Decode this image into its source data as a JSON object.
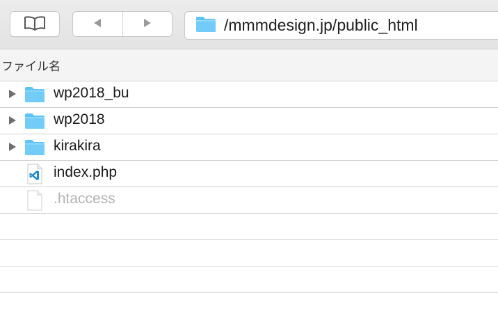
{
  "toolbar": {
    "path": "/mmmdesign.jp/public_html"
  },
  "header": {
    "column_name": "ファイル名"
  },
  "files": [
    {
      "name": "wp2018_bu",
      "kind": "folder",
      "expandable": true,
      "dimmed": false
    },
    {
      "name": "wp2018",
      "kind": "folder",
      "expandable": true,
      "dimmed": false
    },
    {
      "name": "kirakira",
      "kind": "folder",
      "expandable": true,
      "dimmed": false
    },
    {
      "name": "index.php",
      "kind": "php-file",
      "expandable": false,
      "dimmed": false
    },
    {
      "name": ".htaccess",
      "kind": "generic-file",
      "expandable": false,
      "dimmed": true
    }
  ],
  "colors": {
    "folder": "#5ec4f5",
    "folder_tab": "#8dd6f8",
    "vscode_blue": "#1f8ad2",
    "dim_text": "#b3b3b3"
  }
}
